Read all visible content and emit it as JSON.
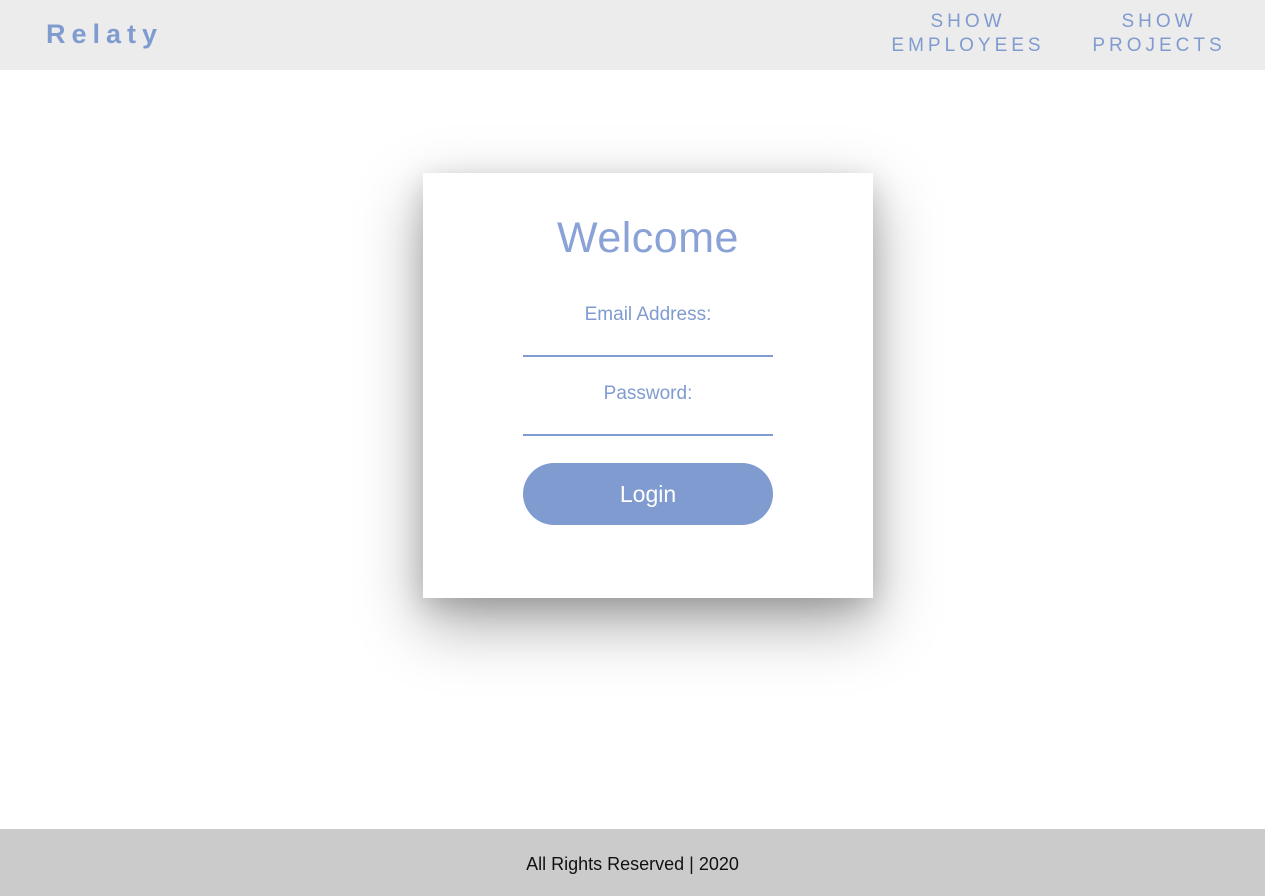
{
  "header": {
    "brand": "Relaty",
    "nav": [
      {
        "line1": "SHOW",
        "line2": "EMPLOYEES"
      },
      {
        "line1": "SHOW",
        "line2": "PROJECTS"
      }
    ]
  },
  "login": {
    "title": "Welcome",
    "email_label": "Email Address:",
    "email_value": "",
    "password_label": "Password:",
    "password_value": "",
    "button_label": "Login"
  },
  "footer": {
    "text": "All Rights Reserved | 2020"
  },
  "colors": {
    "accent": "#7f9bd0",
    "header_bg": "#ececec",
    "footer_bg": "#cbcbcb"
  }
}
